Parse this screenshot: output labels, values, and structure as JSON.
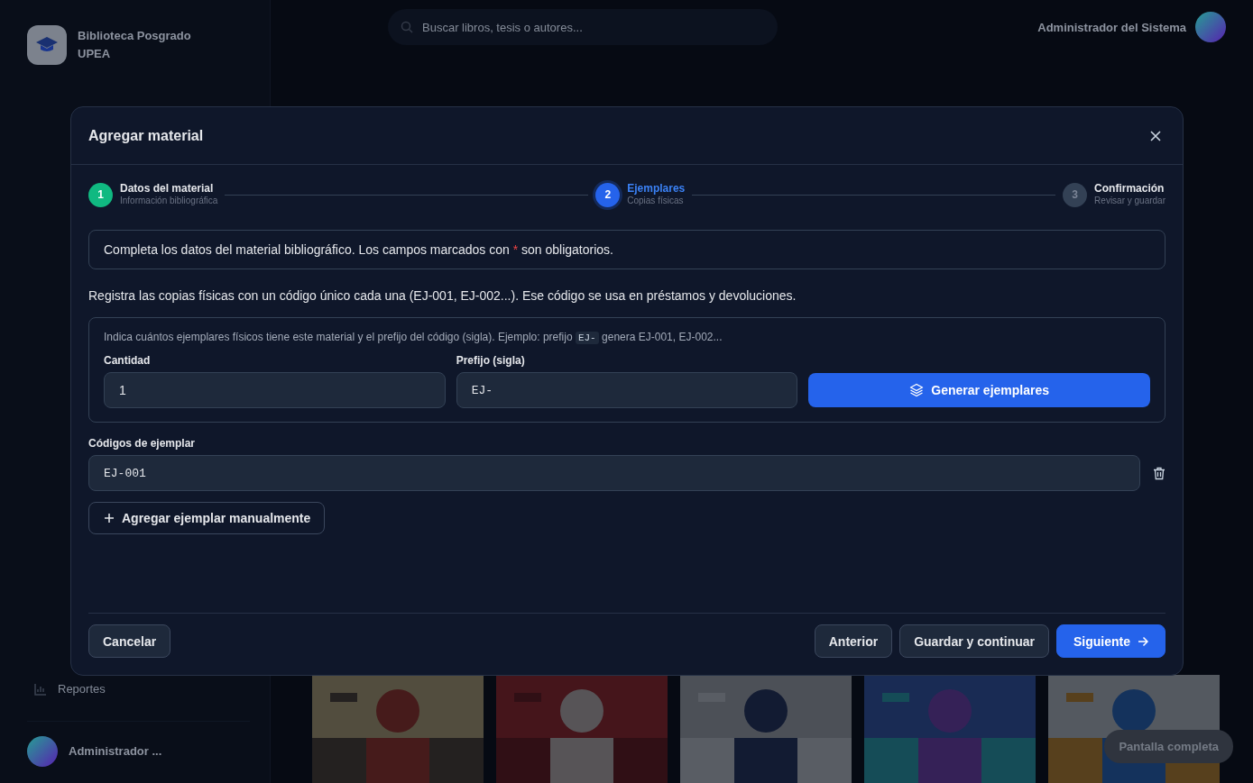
{
  "app": {
    "brand": {
      "title": "Biblioteca Posgrado",
      "subtitle": "UPEA"
    },
    "search": {
      "placeholder": "Buscar libros, tesis o autores..."
    },
    "user": {
      "name": "Administrador del Sistema"
    },
    "sidebar": {
      "items": [
        {
          "label": "Reportes"
        }
      ]
    },
    "footer_user": {
      "name": "Administrador ..."
    },
    "fullscreen_button": "Pantalla completa"
  },
  "dialog": {
    "title": "Agregar material",
    "steps": [
      {
        "number": "1",
        "title": "Datos del material",
        "subtitle": "Información bibliográfica",
        "completed": true,
        "selected": false
      },
      {
        "number": "2",
        "title": "Ejemplares",
        "subtitle": "Copias físicas",
        "completed": false,
        "selected": true
      },
      {
        "number": "3",
        "title": "Confirmación",
        "subtitle": "Revisar y guardar",
        "completed": false,
        "selected": false
      }
    ],
    "notice": {
      "before": "Completa los datos del material bibliográfico. Los campos marcados con",
      "required_mark": "*",
      "after": "son obligatorios."
    },
    "intro": "Registra las copias físicas con un código único cada una (EJ-001, EJ-002...). Ese código se usa en préstamos y devoluciones.",
    "generator": {
      "hint": {
        "before": "Indica cuántos ejemplares físicos tiene este material y el prefijo del código (sigla). Ejemplo: prefijo",
        "code": "EJ-",
        "after": "genera EJ-001, EJ-002..."
      },
      "quantity": {
        "label": "Cantidad",
        "value": "1"
      },
      "prefix": {
        "label": "Prefijo (sigla)",
        "value": "EJ-"
      },
      "button": "Generar ejemplares"
    },
    "codes": {
      "label": "Códigos de ejemplar",
      "items": [
        "EJ-001"
      ]
    },
    "add_manual_button": "Agregar ejemplar manualmente",
    "footer": {
      "cancel": "Cancelar",
      "previous": "Anterior",
      "save": "Guardar y continuar",
      "next": "Siguiente"
    }
  }
}
